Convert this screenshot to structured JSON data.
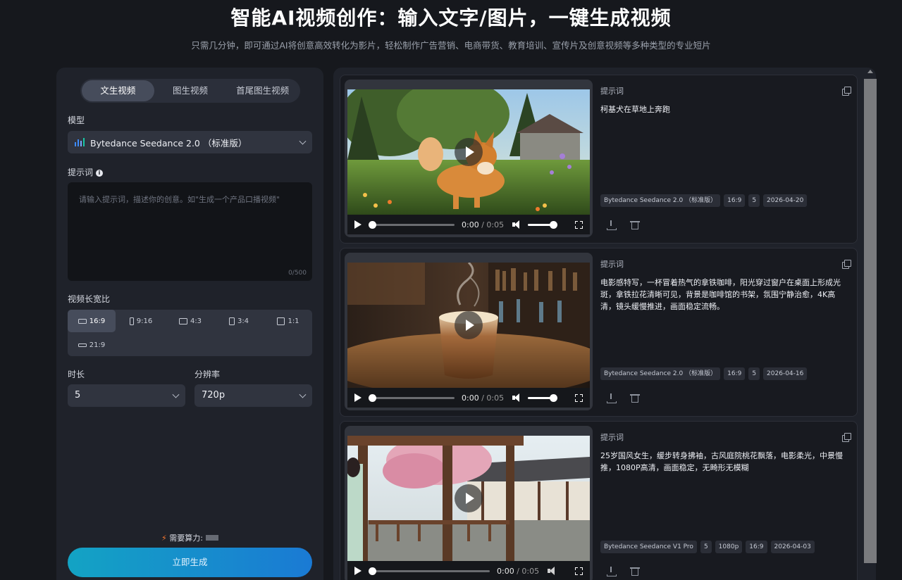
{
  "header": {
    "title": "智能AI视频创作：输入文字/图片，一键生成视频",
    "subtitle": "只需几分钟，即可通过AI将创意高效转化为影片，轻松制作广告营销、电商带货、教育培训、宣传片及创意视频等多种类型的专业短片"
  },
  "left": {
    "tabs": [
      "文生视频",
      "图生视频",
      "首尾图生视频"
    ],
    "active_tab": 0,
    "model_label": "模型",
    "model_value": "Bytedance Seedance 2.0 （标准版）",
    "prompt_label": "提示词",
    "prompt_placeholder": "请输入提示词，描述你的创意。如\"生成一个产品口播视频\"",
    "prompt_counter": "0/500",
    "ratio_label": "视频长宽比",
    "ratios": [
      "16:9",
      "9:16",
      "4:3",
      "3:4",
      "1:1",
      "21:9"
    ],
    "active_ratio": "16:9",
    "duration_label": "时长",
    "duration_value": "5",
    "resolution_label": "分辨率",
    "resolution_value": "720p",
    "cost_label": "需要算力:",
    "generate_button": "立即生成"
  },
  "cards": [
    {
      "prompt_title": "提示词",
      "prompt_text": "柯基犬在草地上奔跑",
      "tags": [
        "Bytedance Seedance 2.0 （标准版）",
        "16:9",
        "5",
        "2026-04-20"
      ],
      "time_current": "0:00",
      "time_total": "0:05"
    },
    {
      "prompt_title": "提示词",
      "prompt_text": "电影感特写，一杯冒着热气的拿铁咖啡，阳光穿过窗户在桌面上形成光斑，拿铁拉花清晰可见，背景是咖啡馆的书架，氛围宁静治愈，4K高清，镜头缓慢推进，画面稳定流畅。",
      "tags": [
        "Bytedance Seedance 2.0 （标准版）",
        "16:9",
        "5",
        "2026-04-16"
      ],
      "time_current": "0:00",
      "time_total": "0:05"
    },
    {
      "prompt_title": "提示词",
      "prompt_text": "25岁国风女生，缓步转身拂袖，古风庭院桃花飘落，电影柔光，中景慢推，1080P高清，画面稳定，无畸形无模糊",
      "tags": [
        "Bytedance Seedance V1 Pro",
        "5",
        "1080p",
        "16:9",
        "2026-04-03"
      ],
      "time_current": "0:00",
      "time_total": "0:05"
    }
  ]
}
